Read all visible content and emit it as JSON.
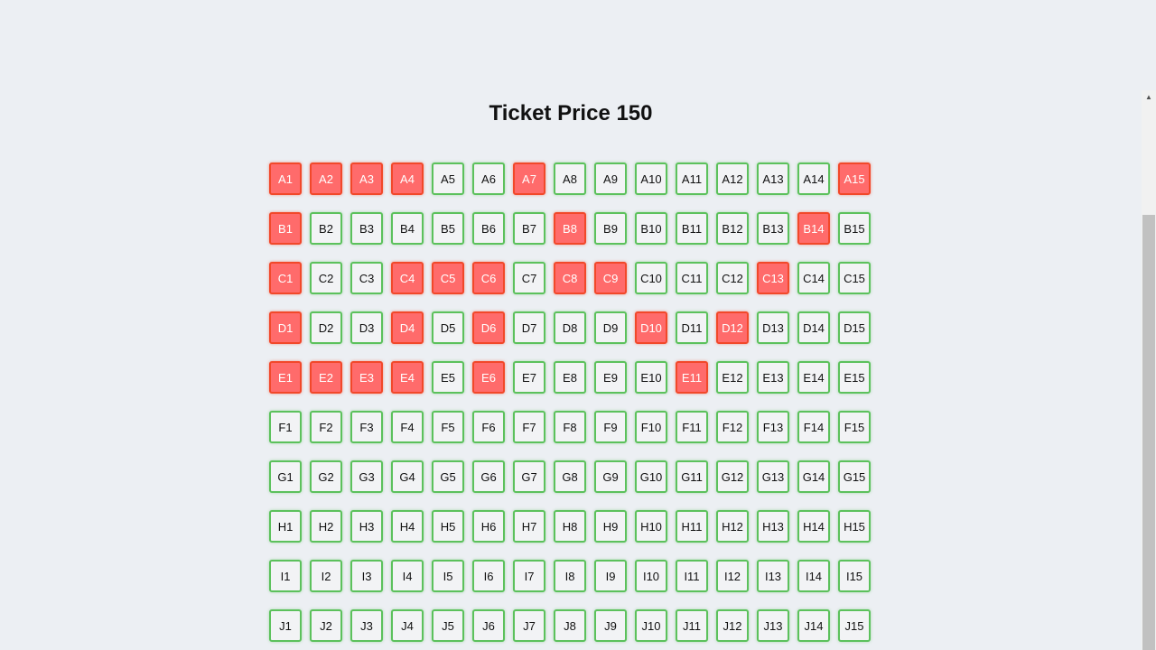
{
  "title": "Ticket Price 150",
  "rows": [
    "A",
    "B",
    "C",
    "D",
    "E",
    "F",
    "G",
    "H",
    "I",
    "J"
  ],
  "seats_per_row": 15,
  "booked": {
    "A": [
      1,
      2,
      3,
      4,
      7,
      15
    ],
    "B": [
      1,
      8,
      14
    ],
    "C": [
      1,
      4,
      5,
      6,
      8,
      9,
      13
    ],
    "D": [
      1,
      4,
      6,
      10,
      12
    ],
    "E": [
      1,
      2,
      3,
      4,
      6,
      11
    ],
    "F": [],
    "G": [],
    "H": [],
    "I": [],
    "J": []
  },
  "colors": {
    "available_border": "#5cc15c",
    "booked_fill": "#ff6b6b",
    "booked_border": "#f2482a",
    "background": "#eceff3"
  },
  "icons": {
    "scroll_up": "triangle-up-icon"
  }
}
